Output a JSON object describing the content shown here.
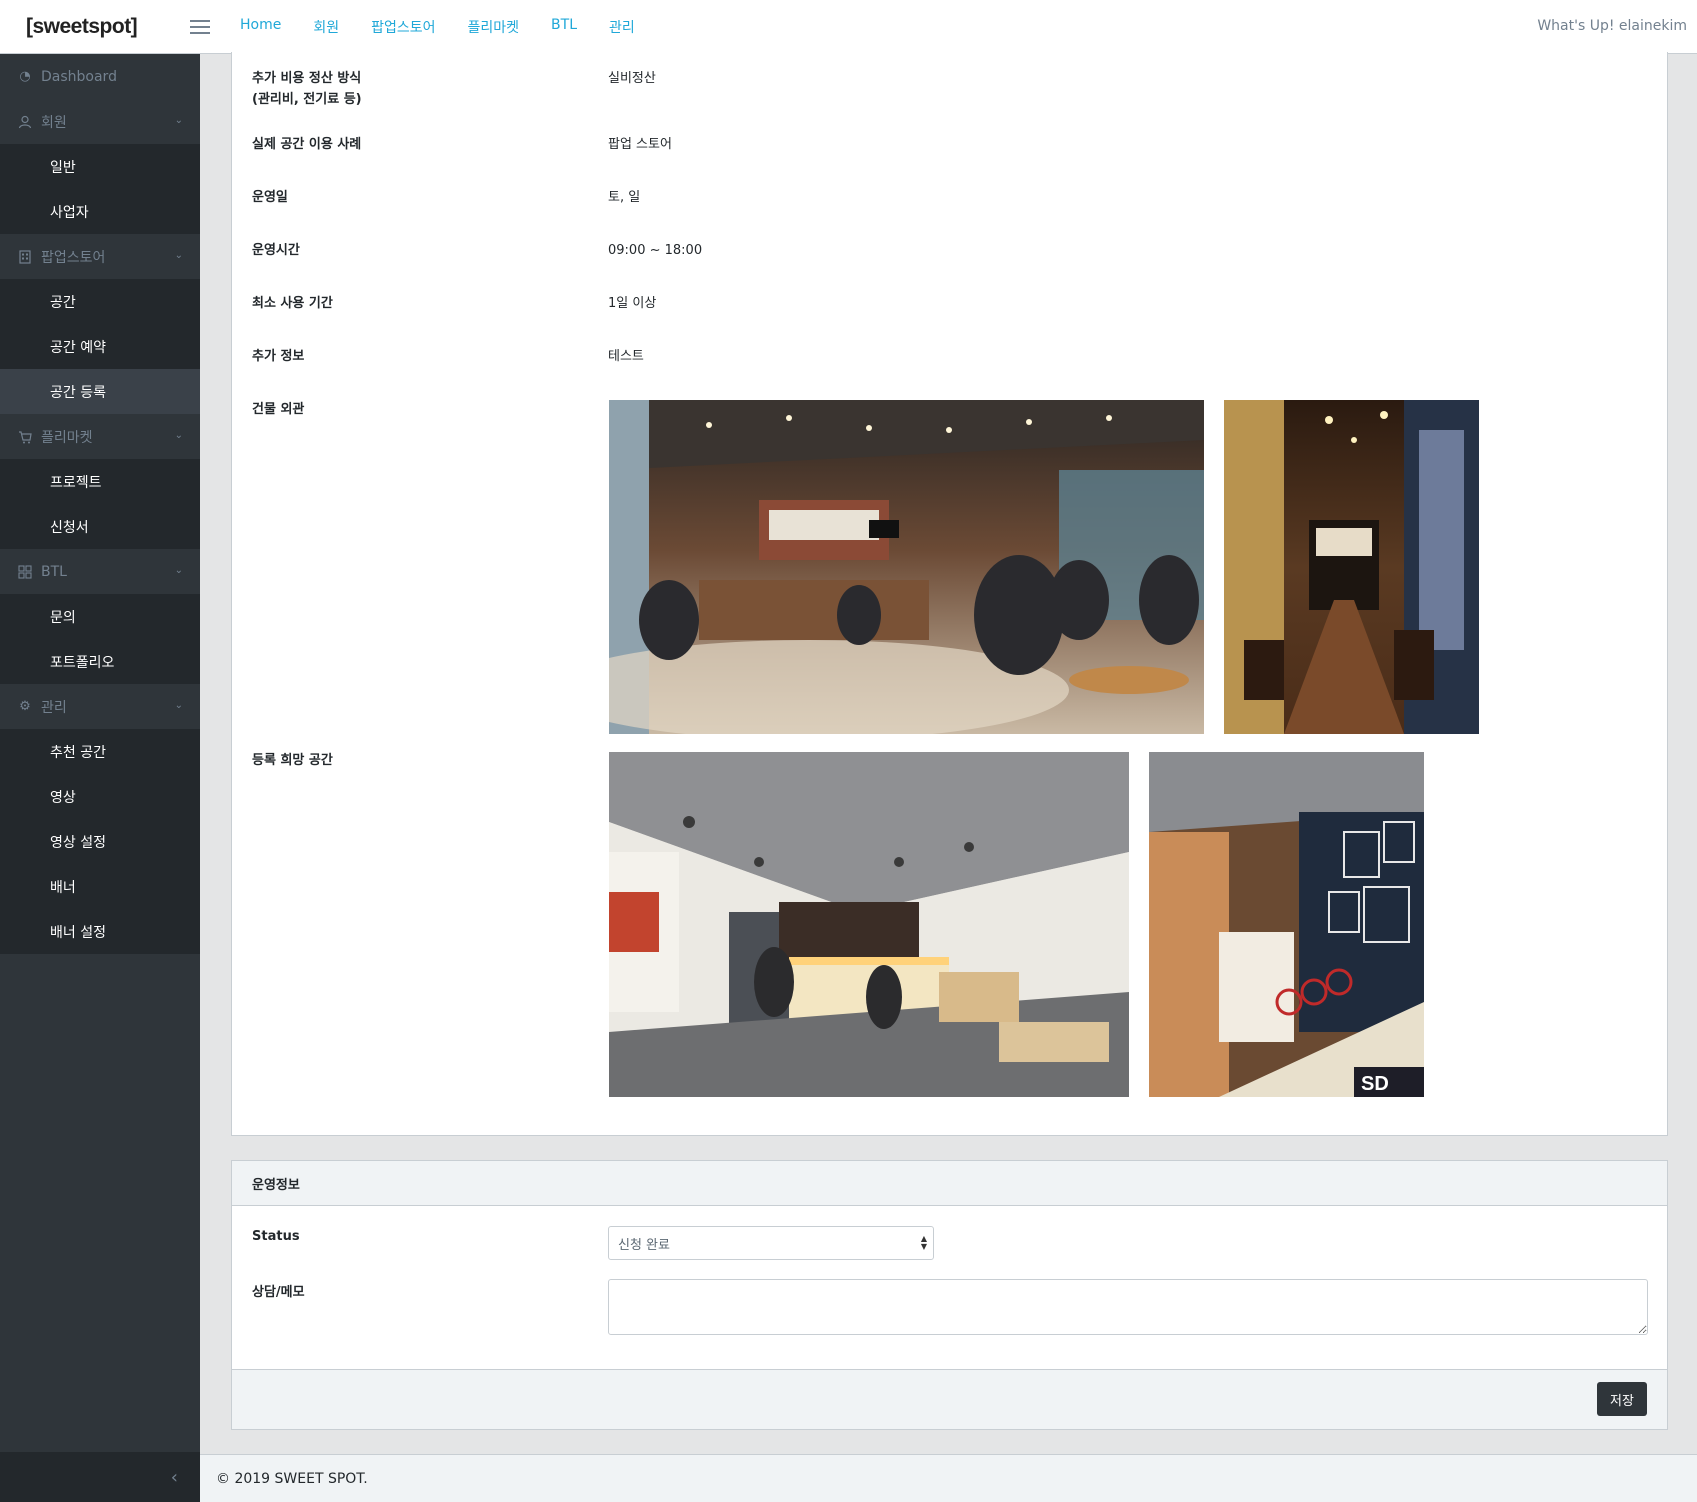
{
  "header": {
    "brand": "[sweetspot]",
    "nav": [
      "Home",
      "회원",
      "팝업스토어",
      "플리마켓",
      "BTL",
      "관리"
    ],
    "greeting": "What's Up! elainekim"
  },
  "sidebar": {
    "dashboard": "Dashboard",
    "groups": [
      {
        "label": "회원",
        "icon": "user-icon",
        "items": [
          "일반",
          "사업자"
        ]
      },
      {
        "label": "팝업스토어",
        "icon": "building-icon",
        "items": [
          "공간",
          "공간 예약",
          "공간 등록"
        ]
      },
      {
        "label": "플리마켓",
        "icon": "basket-icon",
        "items": [
          "프로젝트",
          "신청서"
        ]
      },
      {
        "label": "BTL",
        "icon": "grid-icon",
        "items": [
          "문의",
          "포트폴리오"
        ]
      },
      {
        "label": "관리",
        "icon": "gear-icon",
        "items": [
          "추천 공간",
          "영상",
          "영상 설정",
          "배너",
          "배너 설정"
        ]
      }
    ],
    "active_item": "공간 등록"
  },
  "details": {
    "cost_label_line1": "추가 비용 정산 방식",
    "cost_label_line2": "(관리비, 전기료 등)",
    "cost_value": "실비정산",
    "usage_label": "실제 공간 이용 사례",
    "usage_value": "팝업 스토어",
    "days_label": "운영일",
    "days_value": "토, 일",
    "hours_label": "운영시간",
    "hours_value": "09:00 ~ 18:00",
    "min_period_label": "최소 사용 기간",
    "min_period_value": "1일 이상",
    "extra_label": "추가 정보",
    "extra_value": "테스트",
    "exterior_label": "건물 외관",
    "desired_label": "등록 희망 공간"
  },
  "operation": {
    "title": "운영정보",
    "status_label": "Status",
    "status_value": "신청 완료",
    "memo_label": "상담/메모",
    "memo_value": "",
    "save_label": "저장"
  },
  "footer": {
    "copyright": "© 2019 SWEET SPOT."
  }
}
